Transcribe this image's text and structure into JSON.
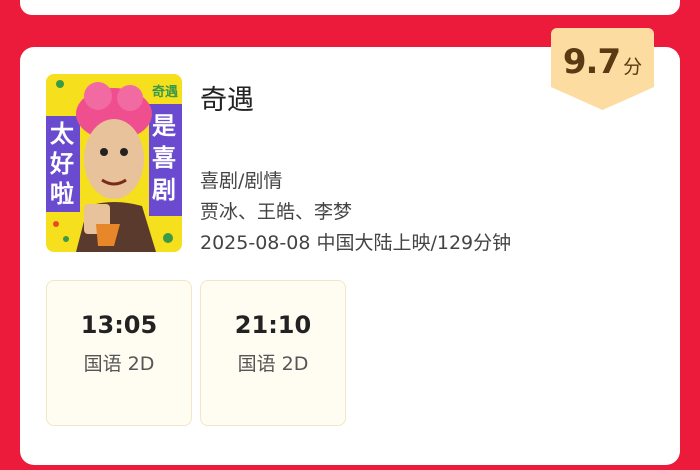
{
  "movie": {
    "score": "9.7",
    "score_unit": "分",
    "title": "奇遇",
    "genre": "喜剧/剧情",
    "cast": "贾冰、王皓、李梦",
    "release": "2025-08-08 中国大陆上映/129分钟",
    "poster": {
      "text_left": [
        "太",
        "好",
        "啦"
      ],
      "text_right": [
        "是",
        "喜",
        "剧"
      ],
      "text_top": "奇遇"
    }
  },
  "showtimes": [
    {
      "time": "13:05",
      "format": "国语 2D"
    },
    {
      "time": "21:10",
      "format": "国语 2D"
    }
  ],
  "colors": {
    "background": "#ec1b3b",
    "badge": "#fcdca0",
    "showtime_bg": "#fffcf2"
  }
}
